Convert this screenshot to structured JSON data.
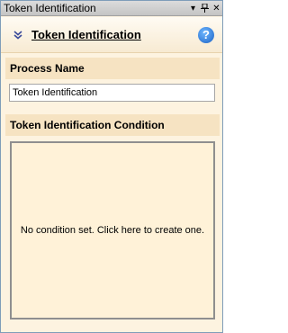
{
  "panel": {
    "title": "Token Identification",
    "pin_glyph": "▾",
    "autohide_glyph": "ꟷ",
    "close_glyph": "✕"
  },
  "header": {
    "title": "Token Identification",
    "collapse_icon": "double-chevron-down-icon",
    "help_glyph": "?"
  },
  "process_name": {
    "label": "Process Name",
    "value": "Token Identification"
  },
  "condition": {
    "label": "Token Identification Condition",
    "empty_text": "No condition set. Click here to create one."
  },
  "colors": {
    "panel_bg": "#fdf3e0",
    "section_bg": "#f6e3c2",
    "condition_bg": "#fff2d8",
    "help_blue": "#1b62c5"
  }
}
